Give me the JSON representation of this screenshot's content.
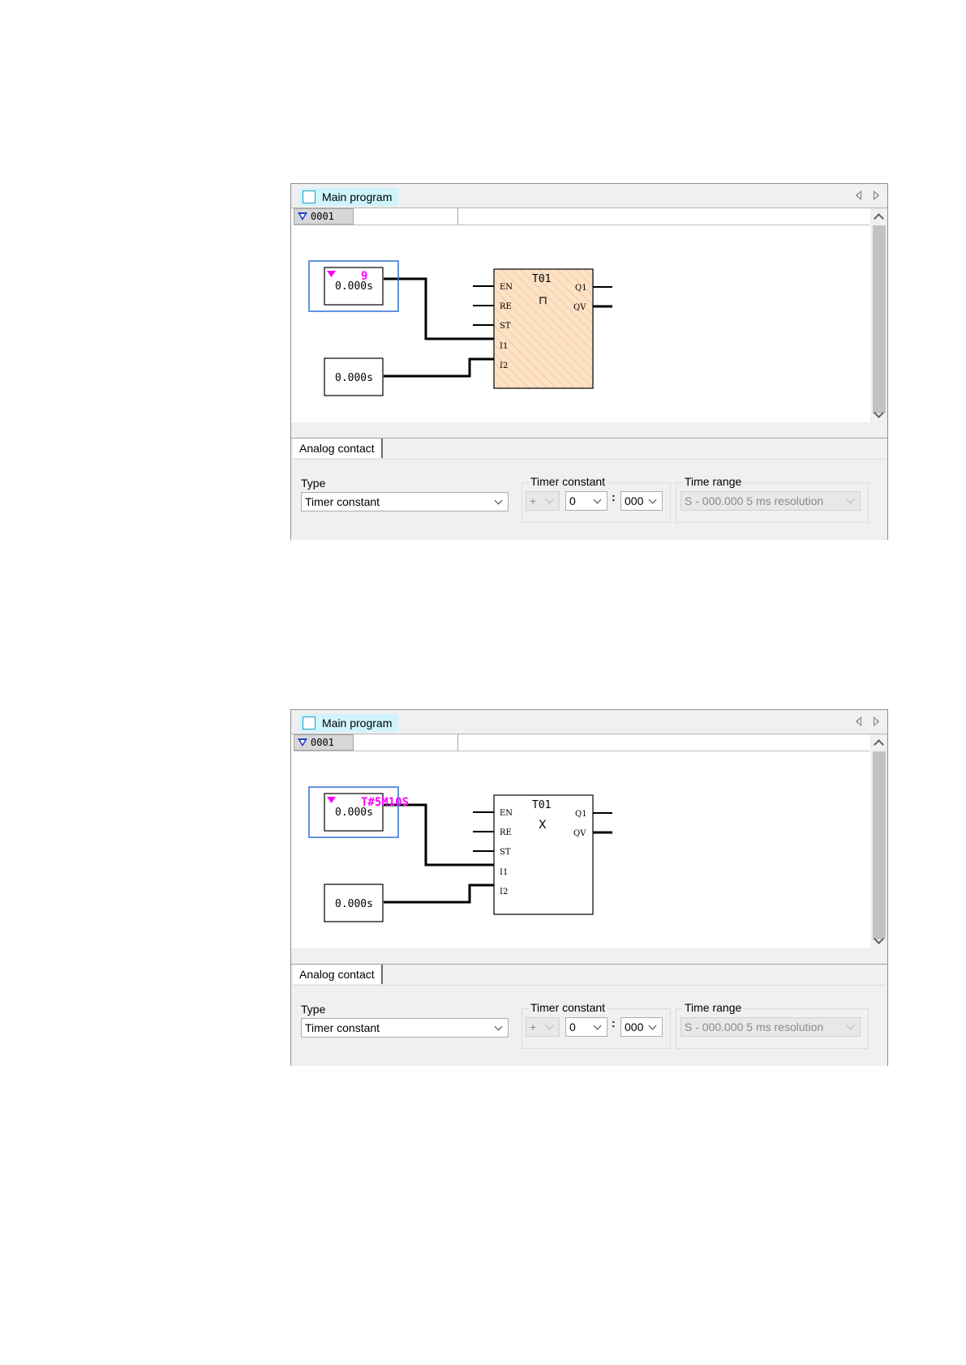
{
  "panels": [
    {
      "title": "Main program",
      "rung_number": "0001",
      "selected_value": "9",
      "contact1_value": "0.000s",
      "contact2_value": "0.000s",
      "block": {
        "name": "T01",
        "symbol": "⊓",
        "inputs": [
          "EN",
          "RE",
          "ST",
          "I1",
          "I2"
        ],
        "outputs": [
          "Q1",
          "QV"
        ]
      },
      "properties": {
        "tab": "Analog contact",
        "type_label": "Type",
        "type_value": "Timer constant",
        "timer_constant_label": "Timer constant",
        "sign_value": "+",
        "minutes_value": "0",
        "colon": ":",
        "ms_value": "000",
        "time_range_label": "Time range",
        "time_range_value": "S - 000.000 5 ms resolution"
      }
    },
    {
      "title": "Main program",
      "rung_number": "0001",
      "selected_value": "T#5M10S",
      "contact1_value": "0.000s",
      "contact2_value": "0.000s",
      "block": {
        "name": "T01",
        "symbol": "X",
        "inputs": [
          "EN",
          "RE",
          "ST",
          "I1",
          "I2"
        ],
        "outputs": [
          "Q1",
          "QV"
        ]
      },
      "properties": {
        "tab": "Analog contact",
        "type_label": "Type",
        "type_value": "Timer constant",
        "timer_constant_label": "Timer constant",
        "sign_value": "+",
        "minutes_value": "0",
        "colon": ":",
        "ms_value": "000",
        "time_range_label": "Time range",
        "time_range_value": "S - 000.000 5 ms resolution"
      }
    }
  ],
  "colors": {
    "accent_magenta": "#ff00ff",
    "selection_blue": "#2f6fd6",
    "block_fill_active": "#fde2c6",
    "tab_highlight": "#cff4fc"
  }
}
